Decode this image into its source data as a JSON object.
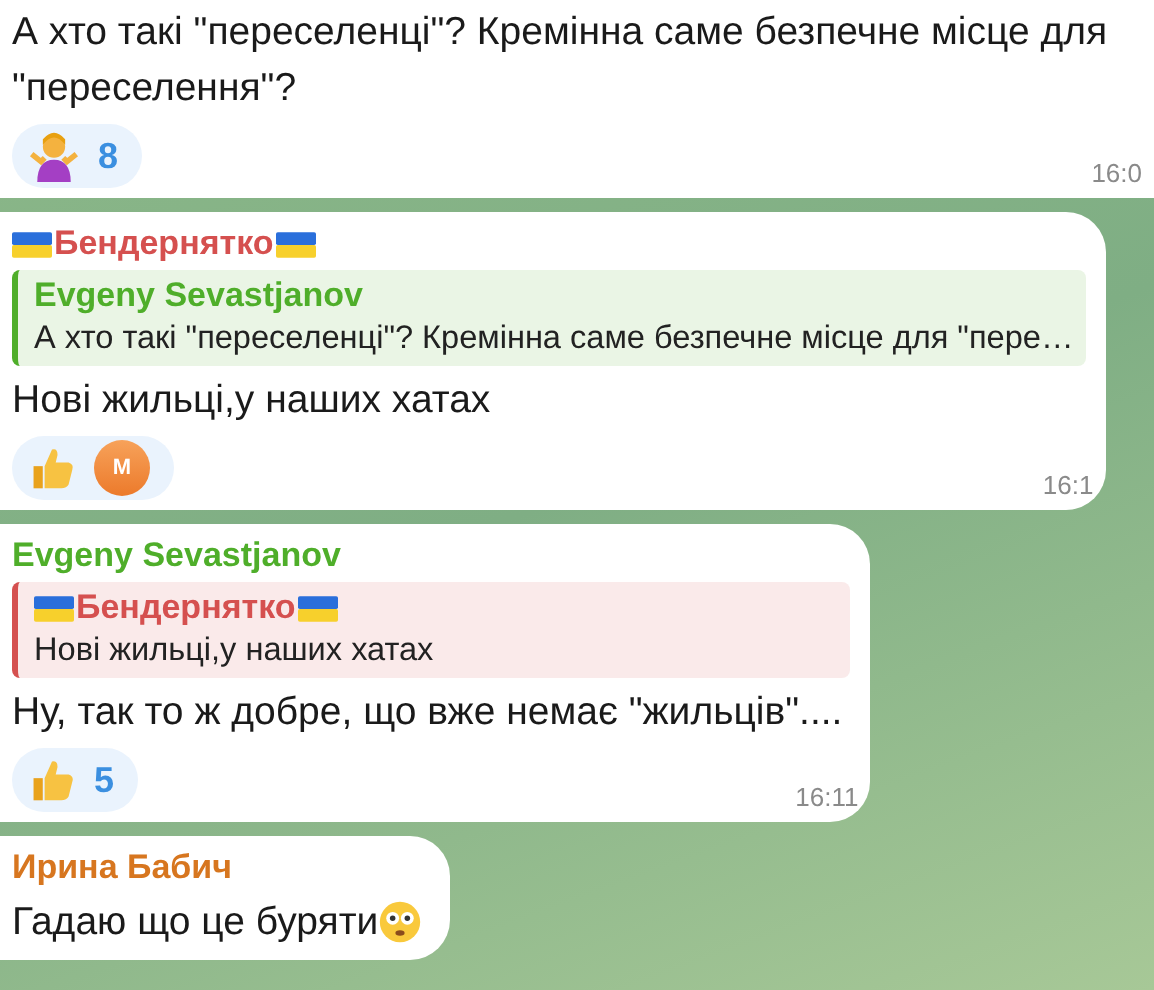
{
  "messages": [
    {
      "text": "А хто такі \"переселенці\"? Кремінна саме безпечне місце для \"переселення\"?",
      "reactions": [
        {
          "kind": "shrug",
          "count": "8"
        }
      ],
      "time": "16:0"
    },
    {
      "sender": {
        "name": "Бендернятко",
        "color": "#d5504f",
        "flag": true
      },
      "reply": {
        "sender": "Evgeny Sevastjanov",
        "flag": false,
        "color": "#4fae2a",
        "text": "А хто такі \"переселенці\"? Кремінна саме безпечне місце для \"пере…"
      },
      "text": "Нові жильці,у наших хатах",
      "reactions": [
        {
          "kind": "thumbs-up",
          "avatars": [
            "М"
          ]
        }
      ],
      "time": "16:1"
    },
    {
      "sender": {
        "name": "Evgeny Sevastjanov",
        "color": "#4fae2a",
        "flag": false
      },
      "reply": {
        "sender": "Бендернятко",
        "flag": true,
        "color": "#d5504f",
        "text": "Нові жильці,у наших хатах"
      },
      "text": "Ну, так то ж добре, що вже немає \"жильців\"....",
      "reactions": [
        {
          "kind": "thumbs-up",
          "count": "5"
        }
      ],
      "time": "16:11"
    },
    {
      "sender": {
        "name": "Ирина Бабич",
        "color": "#d7761f",
        "flag": false
      },
      "text": "Гадаю що це буряти",
      "suffix_icon": {
        "kind": "flushed"
      }
    }
  ]
}
